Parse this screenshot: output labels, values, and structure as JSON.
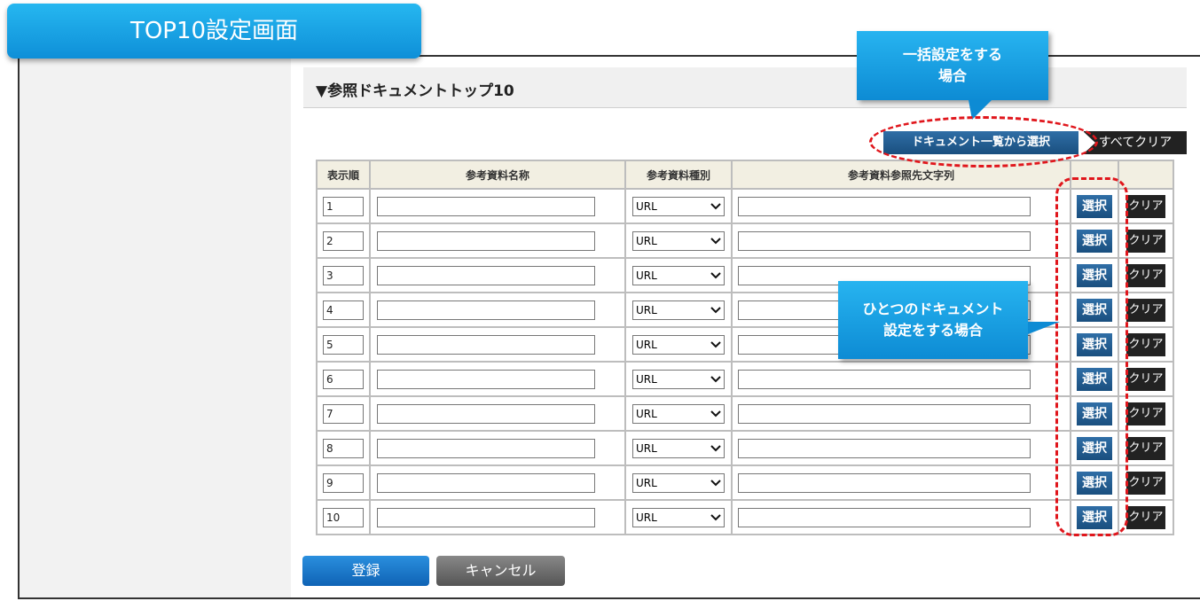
{
  "screen_title": "TOP10設定画面",
  "section_title": "▼参照ドキュメントトップ10",
  "toolbar": {
    "doc_list_select_label": "ドキュメント一覧から選択",
    "clear_all_label": "すべてクリア"
  },
  "table": {
    "headers": [
      "表示順",
      "参考資料名称",
      "参考資料種別",
      "参考資料参照先文字列",
      "",
      ""
    ],
    "rows": [
      {
        "order": "1",
        "type": "URL"
      },
      {
        "order": "2",
        "type": "URL"
      },
      {
        "order": "3",
        "type": "URL"
      },
      {
        "order": "4",
        "type": "URL"
      },
      {
        "order": "5",
        "type": "URL"
      },
      {
        "order": "6",
        "type": "URL"
      },
      {
        "order": "7",
        "type": "URL"
      },
      {
        "order": "8",
        "type": "URL"
      },
      {
        "order": "9",
        "type": "URL"
      },
      {
        "order": "10",
        "type": "URL"
      }
    ],
    "select_label": "選択",
    "clear_label": "クリア"
  },
  "footer": {
    "register_label": "登録",
    "cancel_label": "キャンセル"
  },
  "annotations": {
    "bulk_line1": "一括設定をする",
    "bulk_line2": "場合",
    "single_line1": "ひとつのドキュメント",
    "single_line2": "設定をする場合"
  },
  "colors": {
    "accent_blue": "#0e8fd8",
    "button_blue": "#1a4f7f",
    "annotation_red": "#e0161c"
  }
}
